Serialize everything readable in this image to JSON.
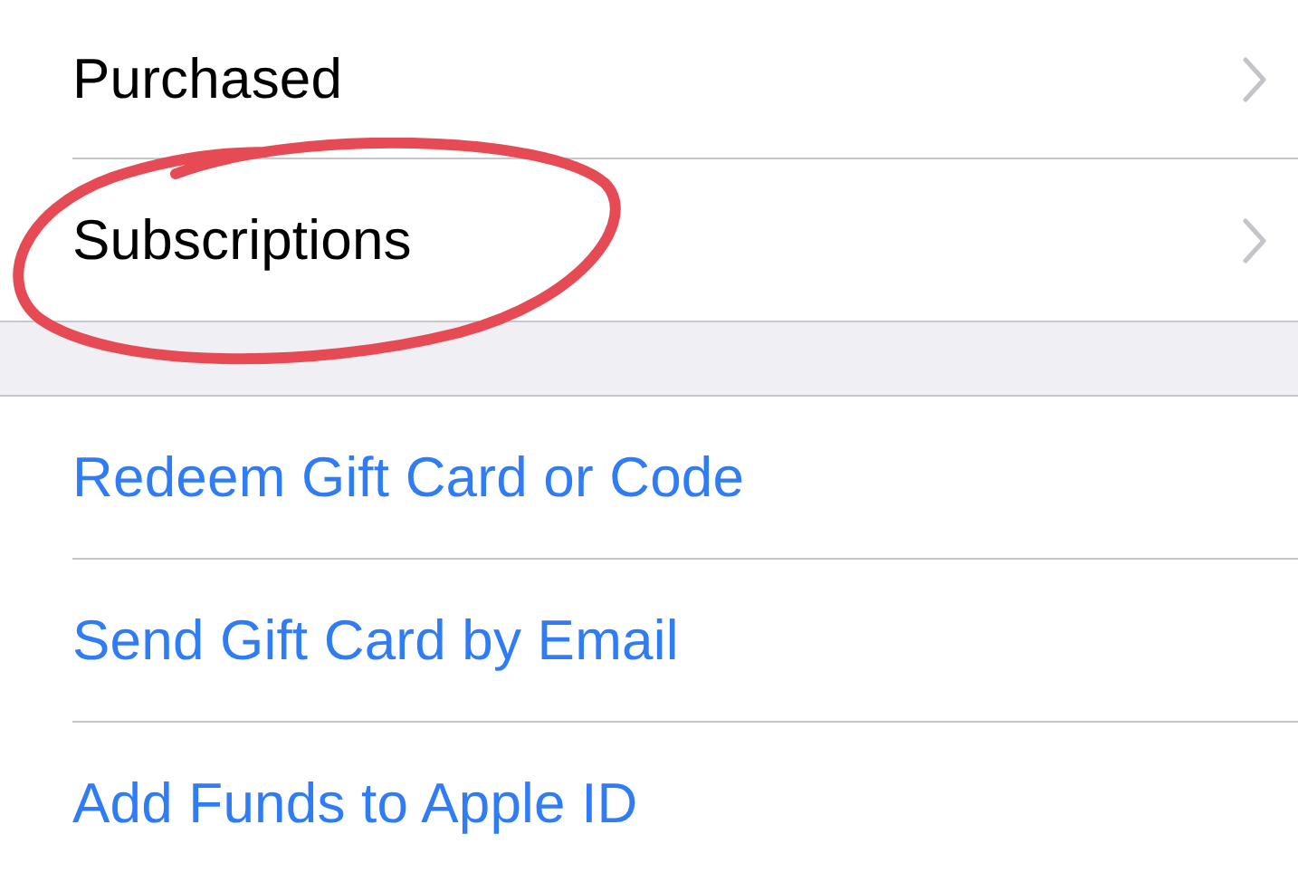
{
  "sections": [
    {
      "items": [
        {
          "label": "Purchased",
          "kind": "nav",
          "circled": false
        },
        {
          "label": "Subscriptions",
          "kind": "nav",
          "circled": true
        }
      ]
    },
    {
      "items": [
        {
          "label": "Redeem Gift Card or Code",
          "kind": "action",
          "circled": false
        },
        {
          "label": "Send Gift Card by Email",
          "kind": "action",
          "circled": false
        },
        {
          "label": "Add Funds to Apple ID",
          "kind": "action",
          "circled": false
        }
      ]
    }
  ]
}
